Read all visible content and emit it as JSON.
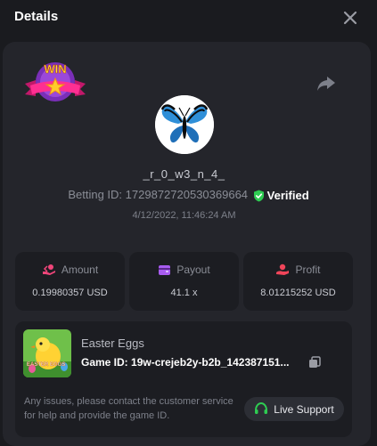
{
  "header": {
    "title": "Details"
  },
  "player": {
    "username": "_r_0_w3_n_4_",
    "betting_id_label": "Betting ID:",
    "betting_id": "1729872720530369664",
    "verified_label": "Verified",
    "timestamp": "4/12/2022, 11:46:24 AM"
  },
  "badge": {
    "text": "WIN"
  },
  "stats": [
    {
      "label": "Amount",
      "value": "0.19980357 USD",
      "icon": "hand-coins-icon",
      "color": "#f0457a"
    },
    {
      "label": "Payout",
      "value": "41.1 x",
      "icon": "wallet-icon",
      "color": "#a85cf0"
    },
    {
      "label": "Profit",
      "value": "8.01215252 USD",
      "icon": "hand-profit-icon",
      "color": "#f0455a"
    }
  ],
  "game": {
    "thumb_text": "EASTER EGGS",
    "name": "Easter Eggs",
    "id_label": "Game ID:",
    "id": "19w-crejeb2y-b2b_142387151...",
    "support_note": "Any issues, please contact the customer service for help and provide the game ID.",
    "live_support_label": "Live Support"
  },
  "colors": {
    "background": "#1a1b1f",
    "card": "#24252b",
    "tile": "#1c1d22",
    "verified": "#2ecc52",
    "support_icon": "#2ecc52"
  }
}
